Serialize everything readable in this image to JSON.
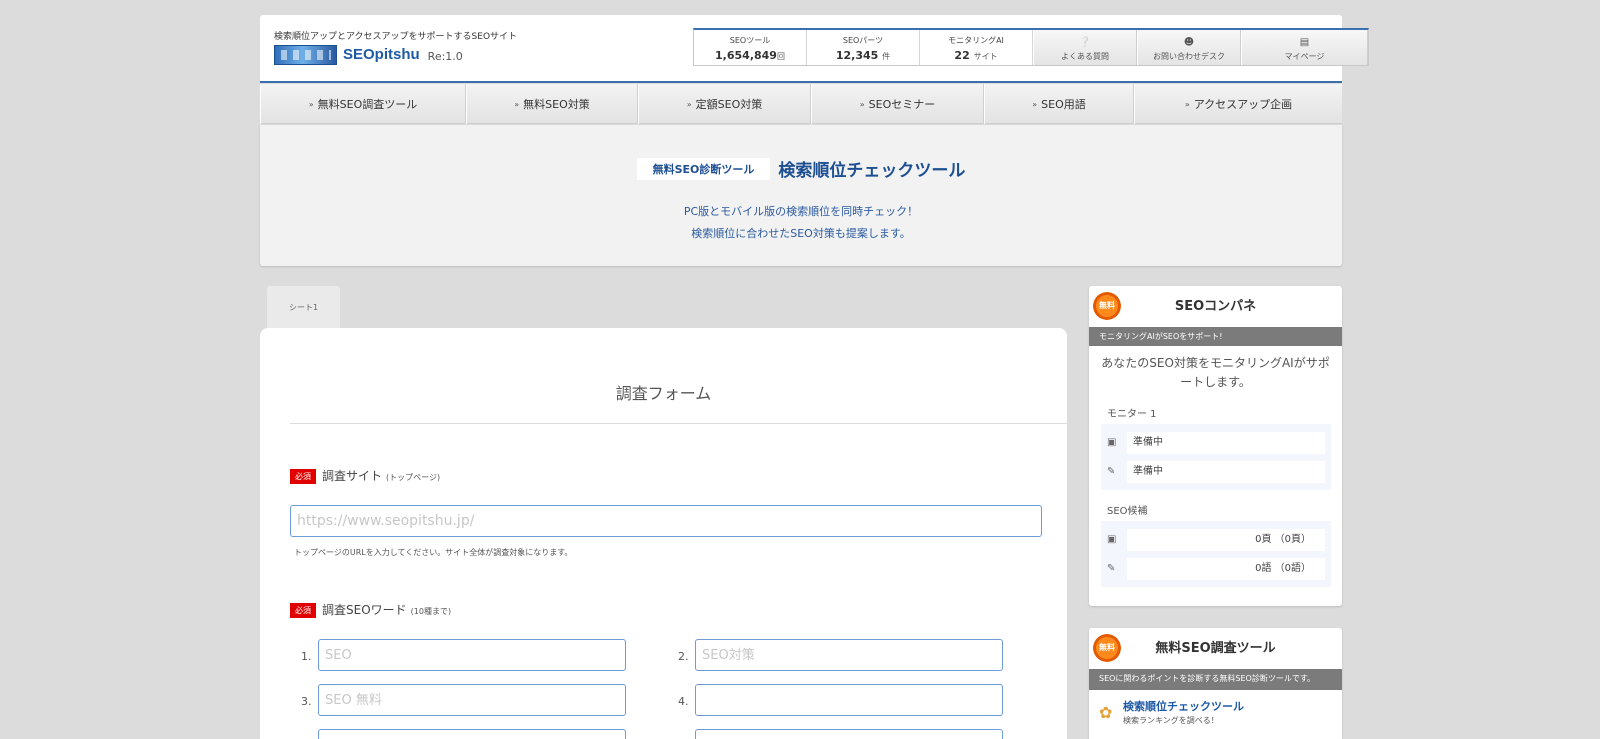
{
  "header": {
    "tagline": "検索順位アップとアクセスアップをサポートするSEOサイト",
    "logo_text": "SEOpitshu",
    "version": "Re:1.0",
    "stats": [
      {
        "label": "SEOツール",
        "value": "1,654,849",
        "unit": "回"
      },
      {
        "label": "SEOパーツ",
        "value": "12,345",
        "unit": "件"
      },
      {
        "label": "モニタリングAI",
        "value": "22",
        "unit": "サイト"
      }
    ],
    "buttons": [
      {
        "icon": "question-icon",
        "label": "よくある質問"
      },
      {
        "icon": "user-icon",
        "label": "お問い合わせデスク"
      },
      {
        "icon": "id-card-icon",
        "label": "マイページ"
      }
    ]
  },
  "nav": [
    "無料SEO調査ツール",
    "無料SEO対策",
    "定額SEO対策",
    "SEOセミナー",
    "SEO用語",
    "アクセスアップ企画"
  ],
  "hero": {
    "badge": "無料SEO診断ツール",
    "title": "検索順位チェックツール",
    "line1": "PC版とモバイル版の検索順位を同時チェック！",
    "line2": "検索順位に合わせたSEO対策も提案します。"
  },
  "tab_label": "シート1",
  "form": {
    "title": "調査フォーム",
    "required_label": "必須",
    "site_label": "調査サイト",
    "site_note": "(トップページ)",
    "site_placeholder": "https://www.seopitshu.jp/",
    "site_hint": "トップページのURLを入力してください。サイト全体が調査対象になります。",
    "keyword_label": "調査SEOワード",
    "keyword_note": "(10種まで)",
    "keywords": [
      {
        "num": "1.",
        "placeholder": "SEO"
      },
      {
        "num": "2.",
        "placeholder": "SEO対策"
      },
      {
        "num": "3.",
        "placeholder": "SEO 無料"
      },
      {
        "num": "4.",
        "placeholder": ""
      }
    ]
  },
  "sidebar": {
    "compane": {
      "badge": "無料",
      "title": "SEOコンパネ",
      "bar": "モニタリングAIがSEOをサポート!",
      "desc": "あなたのSEO対策をモニタリングAIがサポートします。",
      "monitor_label": "モニター 1",
      "monitor_rows": [
        {
          "icon": "window-icon",
          "text": "準備中"
        },
        {
          "icon": "edit-icon",
          "text": "準備中"
        }
      ],
      "candidate_label": "SEO候補",
      "candidate_rows": [
        {
          "icon": "window-icon",
          "text": "0頁 （0頁）"
        },
        {
          "icon": "edit-icon",
          "text": "0語 （0語）"
        }
      ]
    },
    "tools": {
      "badge": "無料",
      "title": "無料SEO調査ツール",
      "bar": "SEOに関わるポイントを診断する無料SEO診断ツールです。",
      "items": [
        {
          "name": "検索順位チェックツール",
          "sub": "検索ランキングを調べる！"
        }
      ]
    }
  }
}
